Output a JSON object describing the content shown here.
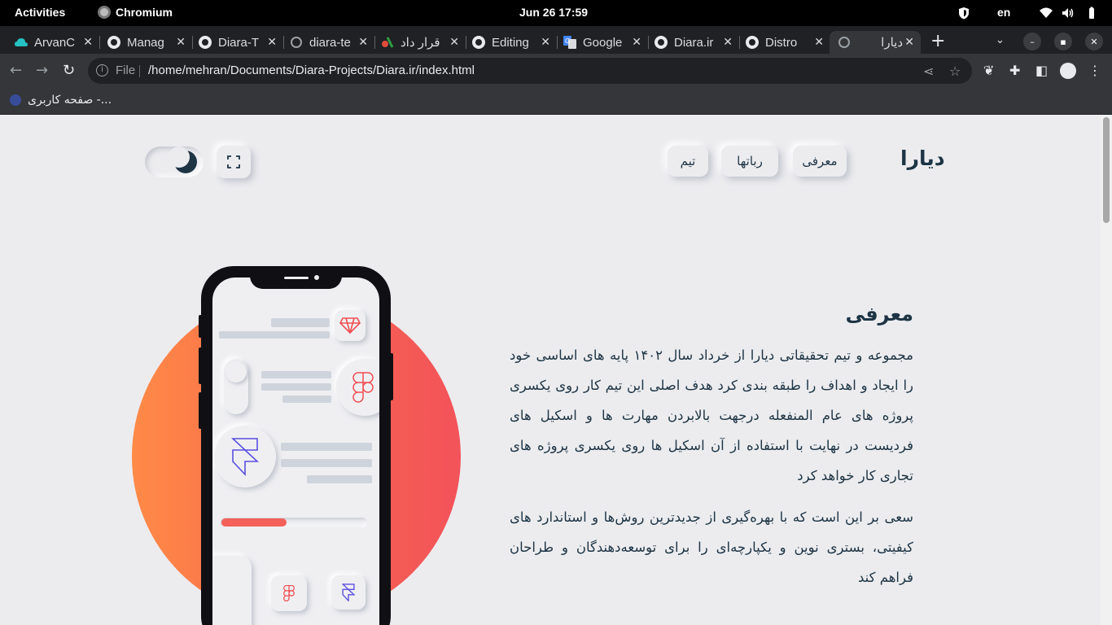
{
  "system": {
    "activities": "Activities",
    "app_name": "Chromium",
    "clock": "Jun 26  17:59",
    "language": "en"
  },
  "browser": {
    "tabs": [
      {
        "title": "ArvanC",
        "icon": "arvan-cloud-icon"
      },
      {
        "title": "Manag",
        "icon": "github-icon"
      },
      {
        "title": "Diara-T",
        "icon": "github-icon"
      },
      {
        "title": "diara-te",
        "icon": "globe-icon"
      },
      {
        "title": "قرار داد",
        "icon": "site-icon"
      },
      {
        "title": "Editing",
        "icon": "github-icon"
      },
      {
        "title": "Google",
        "icon": "google-translate-icon"
      },
      {
        "title": "Diara.ir",
        "icon": "github-icon"
      },
      {
        "title": "Distro",
        "icon": "github-icon"
      },
      {
        "title": "دیارا",
        "icon": "globe-icon",
        "active": true
      }
    ],
    "new_tab": "+",
    "url_scheme": "File",
    "url": "/home/mehran/Documents/Diara-Projects/Diara.ir/index.html",
    "bookmark": "صفحه کاربری -..."
  },
  "site": {
    "brand": "دیارا",
    "nav": [
      "معرفی",
      "رباتها",
      "تیم"
    ],
    "section_title": "معرفی",
    "paragraph_1": "مجموعه و تیم تحقیقاتی دیارا از خرداد سال ۱۴۰۲ پایه های اساسی خود را ایجاد و اهداف را طبقه بندی کرد هدف اصلی این تیم کار روی یکسری پروژه های عام المنفعله درجهت بالابردن مهارت ها و اسکیل های فردیست در نهایت با استفاده از آن اسکیل ها روی یکسری پروژه های تجاری کار خواهد کرد",
    "paragraph_2": "سعی بر این است که با بهره‌گیری از جدیدترین روش‌ها و استاندارد های کیفیتی، بستری نوین و یکپارچه‌ای را برای توسعه‌دهندگان و طراحان فراهم کند",
    "phone_progress": 0.45,
    "colors": {
      "accent": "#f4605a",
      "text": "#1d3444",
      "gradient_start": "#ff8a47",
      "gradient_end": "#f3535a"
    }
  }
}
